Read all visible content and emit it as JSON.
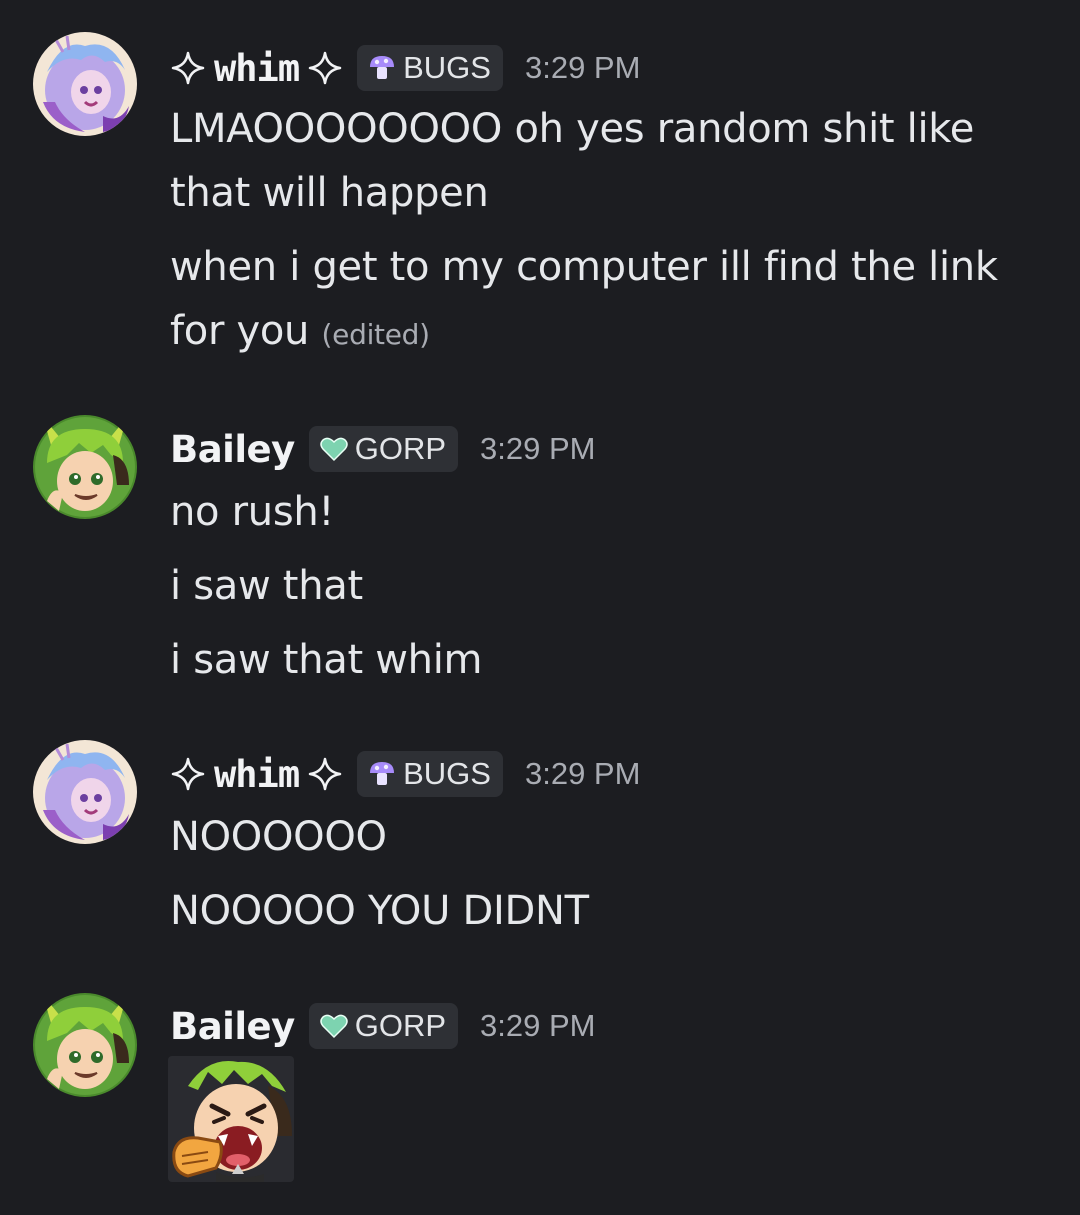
{
  "messages": [
    {
      "author": "whim",
      "tag": "BUGS",
      "time": "3:29 PM",
      "lines": [
        "LMAOOOOOOOO oh yes random shit like",
        "that will happen",
        "when i get to my computer ill find the link",
        "for you"
      ],
      "edited": "(edited)"
    },
    {
      "author": "Bailey",
      "tag": "GORP",
      "time": "3:29 PM",
      "lines": [
        "no rush!",
        "i saw that",
        "i saw that whim"
      ]
    },
    {
      "author": "whim",
      "tag": "BUGS",
      "time": "3:29 PM",
      "lines": [
        "NOOOOOO",
        "NOOOOO YOU DIDNT"
      ]
    },
    {
      "author": "Bailey",
      "tag": "GORP",
      "time": "3:29 PM",
      "sticker": "screaming-pointing-sticker"
    }
  ],
  "colors": {
    "background": "#1c1d21",
    "tag_bg": "#2e3035",
    "username": "#f2f3f5",
    "timestamp": "#a9acb3",
    "bugs_icon": "#a78bfa",
    "gorp_icon": "#7dd3b0"
  }
}
